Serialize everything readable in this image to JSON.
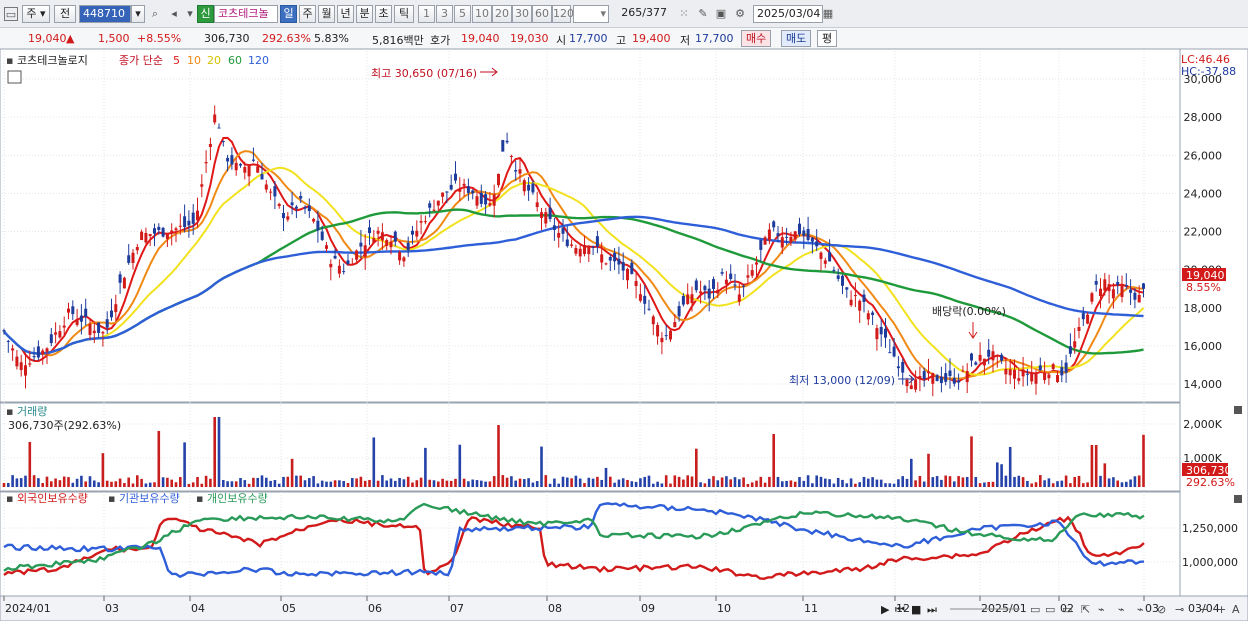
{
  "toolbar": {
    "stock_type": "주",
    "market": "전",
    "code": "448710",
    "new_tag": "신",
    "name": "코츠테크놀",
    "periods": [
      "일",
      "주",
      "월",
      "년",
      "분",
      "초",
      "틱"
    ],
    "selected_period": "일",
    "intervals": [
      "1",
      "3",
      "5",
      "10",
      "20",
      "30",
      "60",
      "120"
    ],
    "count": "265",
    "total": "/377",
    "date": "2025/03/04"
  },
  "info": {
    "price": "19,040",
    "change": "1,500",
    "change_pct": "+8.55%",
    "volume": "306,730",
    "vol_ratio": "292.63%",
    "turnover": "5.83%",
    "amount": "5,816백만",
    "quote_label": "호가",
    "ask": "19,040",
    "bid": "19,030",
    "open_label": "시",
    "open": "17,700",
    "high_label": "고",
    "high": "19,400",
    "low_label": "저",
    "low": "17,700",
    "buy": "매수",
    "sell": "매도",
    "eval": "평"
  },
  "price_panel": {
    "name": "코츠테크놀로지",
    "ma_title": "종가 단순",
    "ma_periods": [
      "5",
      "10",
      "20",
      "60",
      "120"
    ],
    "ma_colors": [
      "#e01818",
      "#f08a14",
      "#f2e21e",
      "#1f9a3a",
      "#2f5fd8"
    ],
    "lc": "LC:46.46",
    "hc": "HC:-37.88",
    "high_note": "최고 30,650 (07/16)",
    "low_note": "최저 13,000 (12/09)",
    "dividend_note": "배당락(0.00%)",
    "last_price": "19,040",
    "last_pct": "8.55%",
    "y_ticks": [
      "30,000",
      "28,000",
      "26,000",
      "24,000",
      "22,000",
      "20,000",
      "18,000",
      "16,000",
      "14,000"
    ]
  },
  "volume_panel": {
    "title": "거래량",
    "value": "306,730주(292.63%)",
    "last": "306,730",
    "last_pct": "292.63%",
    "y_ticks": [
      "2,000K",
      "1,000K"
    ]
  },
  "holding_panel": {
    "titles": [
      "외국인보유수량",
      "기관보유수량",
      "개인보유수량"
    ],
    "colors": [
      "#d21a1a",
      "#2f5fd8",
      "#2a9a58"
    ],
    "y_ticks": [
      "1,250,000",
      "1,000,000"
    ]
  },
  "x_axis": [
    "2024/01",
    "03",
    "04",
    "05",
    "06",
    "07",
    "08",
    "09",
    "10",
    "11",
    "12",
    "2025/01",
    "02",
    "03"
  ],
  "x_right": "03/04",
  "chart_data": {
    "type": "candlestick",
    "x_range": [
      "2024/01",
      "2025/03/04"
    ],
    "ylim": [
      12500,
      30650
    ],
    "points": [
      [
        0,
        17.2
      ],
      [
        20,
        15.0
      ],
      [
        45,
        15.8
      ],
      [
        70,
        17.8
      ],
      [
        105,
        16.6
      ],
      [
        120,
        19.2
      ],
      [
        140,
        21.8
      ],
      [
        165,
        22.0
      ],
      [
        195,
        22.4
      ],
      [
        208,
        26.2
      ],
      [
        216,
        28.4
      ],
      [
        225,
        26.0
      ],
      [
        240,
        25.2
      ],
      [
        255,
        25.8
      ],
      [
        270,
        24.0
      ],
      [
        285,
        22.8
      ],
      [
        300,
        23.5
      ],
      [
        315,
        22.5
      ],
      [
        330,
        20.6
      ],
      [
        345,
        20.0
      ],
      [
        360,
        21.2
      ],
      [
        375,
        22.0
      ],
      [
        390,
        21.8
      ],
      [
        405,
        20.8
      ],
      [
        420,
        22.4
      ],
      [
        440,
        23.8
      ],
      [
        455,
        24.4
      ],
      [
        470,
        24.2
      ],
      [
        490,
        23.4
      ],
      [
        500,
        25.2
      ],
      [
        505,
        27.2
      ],
      [
        515,
        25.5
      ],
      [
        530,
        24.0
      ],
      [
        545,
        22.8
      ],
      [
        560,
        21.8
      ],
      [
        575,
        21.2
      ],
      [
        590,
        21.5
      ],
      [
        605,
        20.5
      ],
      [
        620,
        20.2
      ],
      [
        640,
        19.0
      ],
      [
        655,
        17.2
      ],
      [
        665,
        16.4
      ],
      [
        680,
        17.8
      ],
      [
        695,
        19.0
      ],
      [
        710,
        18.6
      ],
      [
        725,
        19.8
      ],
      [
        740,
        18.6
      ],
      [
        755,
        20.2
      ],
      [
        770,
        22.0
      ],
      [
        785,
        21.8
      ],
      [
        800,
        22.0
      ],
      [
        815,
        21.2
      ],
      [
        830,
        20.4
      ],
      [
        845,
        18.8
      ],
      [
        860,
        18.4
      ],
      [
        875,
        17.2
      ],
      [
        890,
        15.8
      ],
      [
        905,
        14.6
      ],
      [
        915,
        14.0
      ],
      [
        930,
        14.4
      ],
      [
        945,
        14.2
      ],
      [
        960,
        14.3
      ],
      [
        975,
        15.2
      ],
      [
        990,
        15.6
      ],
      [
        1005,
        14.8
      ],
      [
        1020,
        14.5
      ],
      [
        1035,
        14.6
      ],
      [
        1050,
        14.8
      ],
      [
        1065,
        14.6
      ],
      [
        1075,
        16.2
      ],
      [
        1085,
        17.5
      ],
      [
        1095,
        19.0
      ],
      [
        1105,
        19.4
      ],
      [
        1115,
        18.9
      ],
      [
        1125,
        19.0
      ],
      [
        1140,
        18.5
      ],
      [
        1146,
        19.04
      ]
    ]
  }
}
